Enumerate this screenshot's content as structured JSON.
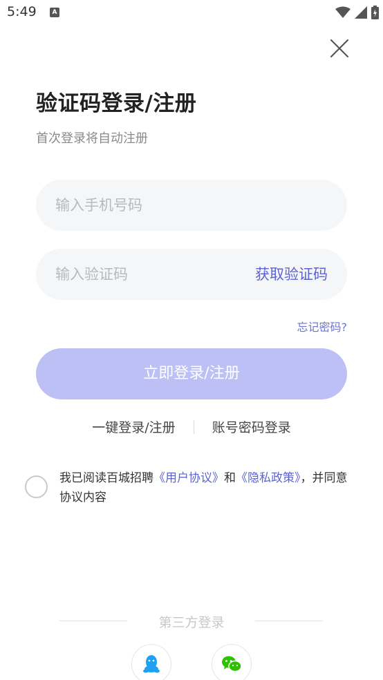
{
  "status_bar": {
    "time": "5:49",
    "notification_icon": "a-icon"
  },
  "header": {
    "title": "验证码登录/注册",
    "subtitle": "首次登录将自动注册"
  },
  "form": {
    "phone_placeholder": "输入手机号码",
    "code_placeholder": "输入验证码",
    "get_code_label": "获取验证码",
    "forgot_label": "忘记密码?",
    "login_label": "立即登录/注册"
  },
  "alt_login": {
    "one_click": "一键登录/注册",
    "password_login": "账号密码登录"
  },
  "agreement": {
    "prefix": "我已阅读百城招聘",
    "user_agreement": "《用户协议》",
    "and": "和",
    "privacy_policy": "《隐私政策》",
    "suffix": "，并同意协议内容"
  },
  "third_party": {
    "title": "第三方登录",
    "icons": [
      "qq-icon",
      "wechat-icon"
    ]
  },
  "colors": {
    "accent": "#5b63d3",
    "button_disabled": "#bcc0f5",
    "input_bg": "#f5f6f8",
    "qq_blue": "#1ea1f2",
    "wechat_green": "#2dc100"
  }
}
